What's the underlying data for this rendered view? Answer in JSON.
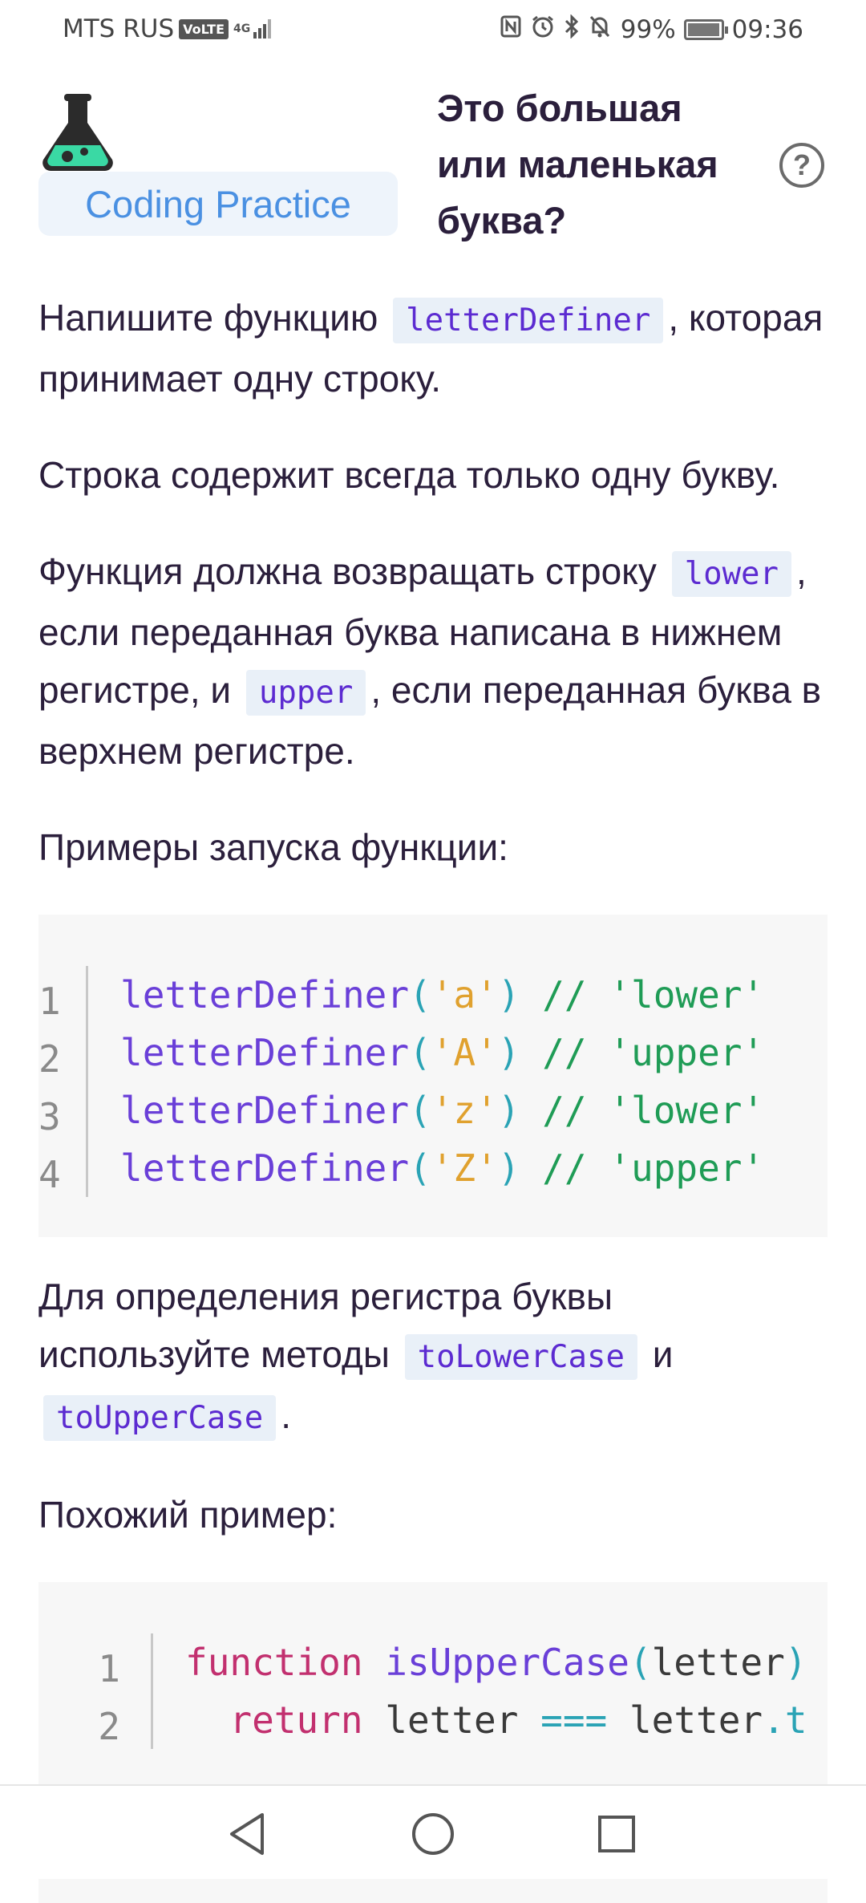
{
  "status_bar": {
    "carrier": "MTS RUS",
    "volte": "VoLTE",
    "network": "4G",
    "battery": "99%",
    "battery_level": 0.99,
    "time": "09:36"
  },
  "header": {
    "category_label": "Coding Practice",
    "title": "Это большая или маленькая буква?",
    "help_label": "?"
  },
  "content": {
    "p1": {
      "before": "Напишите функцию ",
      "code": "letterDefiner",
      "after": ", которая принимает одну строку."
    },
    "p2": "Строка содержит всегда только одну букву.",
    "p3": {
      "before": "Функция должна возвращать строку ",
      "code1": "lower",
      "middle": ", если переданная буква написана в нижнем регистре, и ",
      "code2": "upper",
      "after": ", если переданная буква в верхнем регистре."
    },
    "examples_heading": "Примеры запуска функции:",
    "examples": [
      {
        "num": "1",
        "fn": "letterDefiner",
        "open": "(",
        "arg": "'a'",
        "close": ")",
        "comment": " // 'lower'"
      },
      {
        "num": "2",
        "fn": "letterDefiner",
        "open": "(",
        "arg": "'A'",
        "close": ")",
        "comment": " // 'upper'"
      },
      {
        "num": "3",
        "fn": "letterDefiner",
        "open": "(",
        "arg": "'z'",
        "close": ")",
        "comment": " // 'lower'"
      },
      {
        "num": "4",
        "fn": "letterDefiner",
        "open": "(",
        "arg": "'Z'",
        "close": ")",
        "comment": " // 'upper'"
      }
    ],
    "p4": {
      "before": "Для определения регистра буквы используйте методы ",
      "code1": "toLowerCase",
      "middle": " и ",
      "code2": "toUpperCase",
      "after": "."
    },
    "similar_heading": "Похожий пример:",
    "snippet": {
      "line1": {
        "num": "1",
        "kw": "function",
        "fn": "isUpperCase",
        "open": "(",
        "param": "letter",
        "close": ")"
      },
      "line2": {
        "num": "2",
        "indent": "  ",
        "kw": "return",
        "var": "letter",
        "op": "===",
        "var2": "letter",
        "dot": ".",
        "rest": "t"
      }
    }
  },
  "colors": {
    "accent": "#4a90e2",
    "inline_code": "#5c2bd1",
    "text": "#2b1f3c"
  },
  "nav": {
    "back_icon": "back-triangle-icon",
    "home_icon": "home-circle-icon",
    "recents_icon": "recents-square-icon"
  }
}
